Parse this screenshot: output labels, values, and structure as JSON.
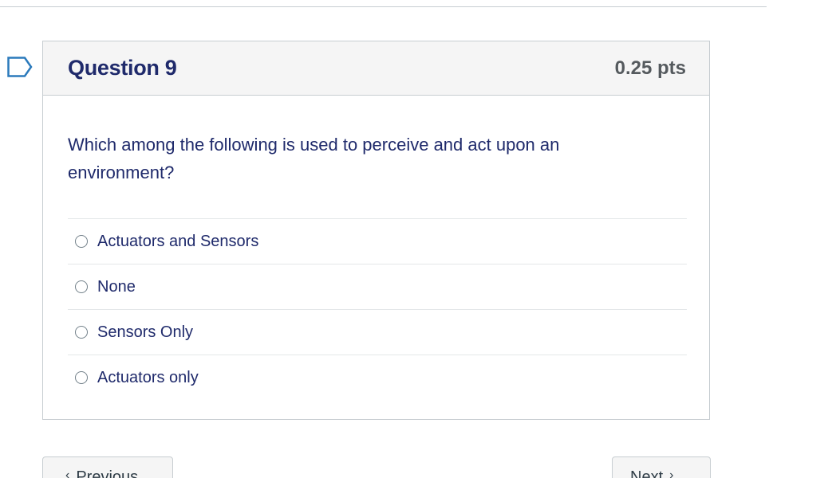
{
  "question": {
    "title": "Question 9",
    "points": "0.25 pts",
    "text": "Which among the following is used to perceive and act upon an environment?",
    "answers": [
      {
        "label": "Actuators and Sensors"
      },
      {
        "label": "None"
      },
      {
        "label": "Sensors Only"
      },
      {
        "label": "Actuators only"
      }
    ]
  },
  "navigation": {
    "previous_label": "Previous",
    "next_label": "Next"
  },
  "colors": {
    "heading": "#1f2a6b",
    "border": "#c7cdd1",
    "header_bg": "#f5f5f5",
    "flag": "#2b7abc"
  },
  "icons": {
    "flag": "flag-icon",
    "radio": "radio-icon",
    "prev": "chevron-left-icon",
    "next": "chevron-right-icon"
  }
}
